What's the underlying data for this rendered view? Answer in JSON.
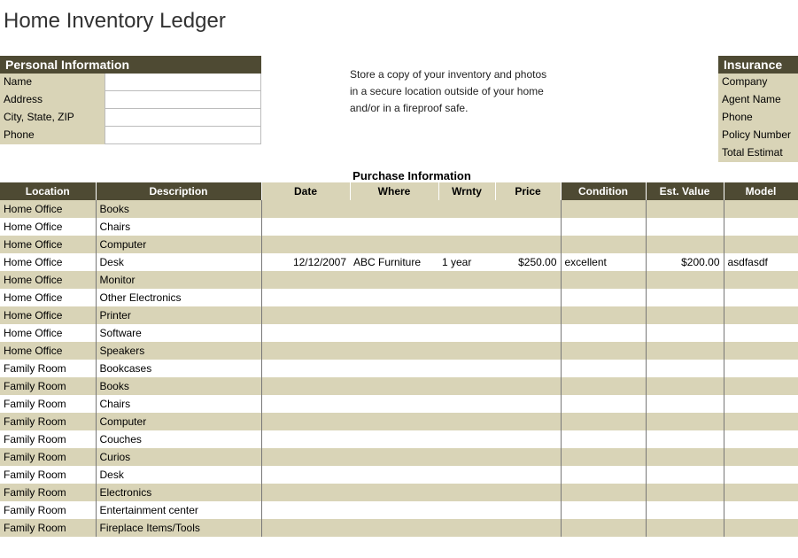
{
  "title": "Home Inventory Ledger",
  "personal": {
    "header": "Personal Information",
    "labels": {
      "name": "Name",
      "address": "Address",
      "csz": "City, State, ZIP",
      "phone": "Phone"
    },
    "values": {
      "name": "",
      "address": "",
      "csz": "",
      "phone": ""
    }
  },
  "note": {
    "l1": "Store a copy of your inventory and photos",
    "l2": "in a secure location outside of your home",
    "l3": "and/or in a fireproof safe."
  },
  "insurance": {
    "header": "Insurance",
    "labels": {
      "company": "Company",
      "agent": "Agent Name",
      "phone": "Phone",
      "policy": "Policy Number",
      "total": "Total Estimat"
    }
  },
  "purchase_section": "Purchase Information",
  "headers": {
    "location": "Location",
    "description": "Description",
    "date": "Date",
    "where": "Where",
    "wrnty": "Wrnty",
    "price": "Price",
    "condition": "Condition",
    "estvalue": "Est. Value",
    "model": "Model"
  },
  "rows": [
    {
      "location": "Home Office",
      "description": "Books"
    },
    {
      "location": "Home Office",
      "description": "Chairs"
    },
    {
      "location": "Home Office",
      "description": "Computer"
    },
    {
      "location": "Home Office",
      "description": "Desk",
      "date": "12/12/2007",
      "where": "ABC Furniture",
      "wrnty": "1 year",
      "price": "$250.00",
      "condition": "excellent",
      "estvalue": "$200.00",
      "model": "asdfasdf"
    },
    {
      "location": "Home Office",
      "description": "Monitor"
    },
    {
      "location": "Home Office",
      "description": "Other Electronics"
    },
    {
      "location": "Home Office",
      "description": "Printer"
    },
    {
      "location": "Home Office",
      "description": "Software"
    },
    {
      "location": "Home Office",
      "description": "Speakers"
    },
    {
      "location": "Family Room",
      "description": "Bookcases"
    },
    {
      "location": "Family Room",
      "description": "Books"
    },
    {
      "location": "Family Room",
      "description": "Chairs"
    },
    {
      "location": "Family Room",
      "description": "Computer"
    },
    {
      "location": "Family Room",
      "description": "Couches"
    },
    {
      "location": "Family Room",
      "description": "Curios"
    },
    {
      "location": "Family Room",
      "description": "Desk"
    },
    {
      "location": "Family Room",
      "description": "Electronics"
    },
    {
      "location": "Family Room",
      "description": "Entertainment center"
    },
    {
      "location": "Family Room",
      "description": "Fireplace Items/Tools"
    }
  ]
}
